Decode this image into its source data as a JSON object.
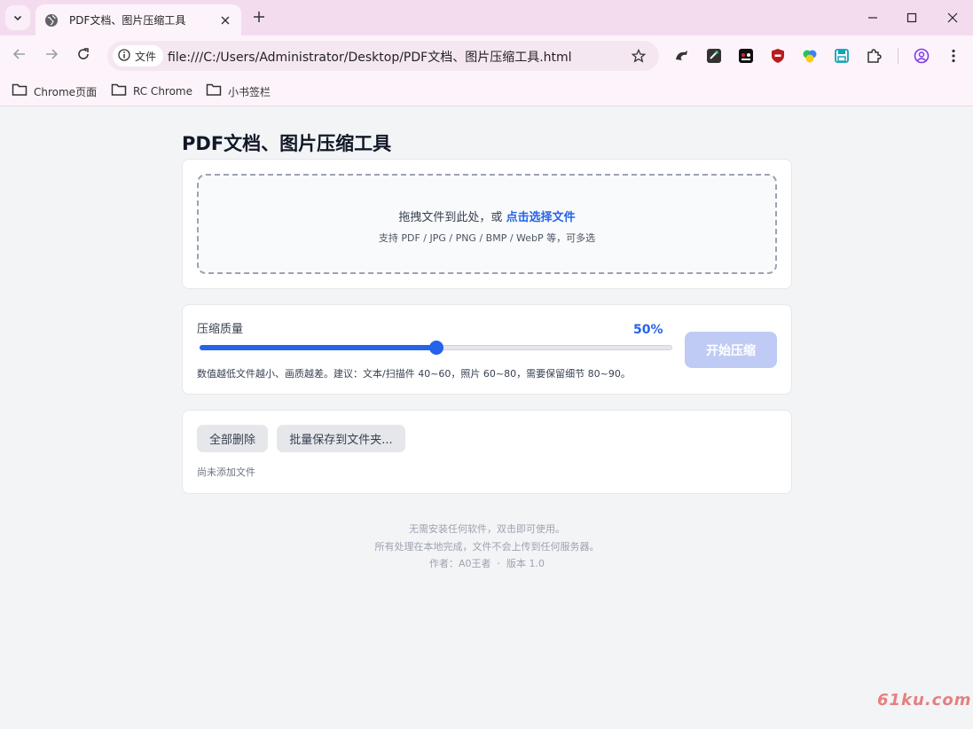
{
  "browser": {
    "tab": {
      "title": "PDF文档、图片压缩工具"
    },
    "address": {
      "chip_label": "文件",
      "url": "file:///C:/Users/Administrator/Desktop/PDF文档、图片压缩工具.html"
    },
    "bookmarks": [
      {
        "label": "Chrome页面"
      },
      {
        "label": "RC Chrome"
      },
      {
        "label": "小书签栏"
      }
    ]
  },
  "page": {
    "title": "PDF文档、图片压缩工具",
    "dropzone": {
      "text": "拖拽文件到此处，或",
      "link": "点击选择文件",
      "hint": "支持 PDF / JPG / PNG / BMP / WebP 等，可多选"
    },
    "quality": {
      "label": "压缩质量",
      "value_text": "50%",
      "value_fraction": 0.5,
      "start_button": "开始压缩",
      "hint": "数值越低文件越小、画质越差。建议：文本/扫描件 40~60，照片 60~80，需要保留细节 80~90。"
    },
    "files": {
      "delete_all": "全部删除",
      "batch_save": "批量保存到文件夹...",
      "empty_text": "尚未添加文件"
    },
    "footer": {
      "line1": "无需安装任何软件，双击即可使用。",
      "line2": "所有处理在本地完成，文件不会上传到任何服务器。",
      "line3": "作者：A0王者  ·  版本 1.0"
    }
  },
  "watermark": "61ku.com",
  "colors": {
    "accent": "#2563eb",
    "tabstrip": "#f4dcef",
    "toolbar": "#fdf4fb",
    "page_bg": "#f3f4f6"
  }
}
